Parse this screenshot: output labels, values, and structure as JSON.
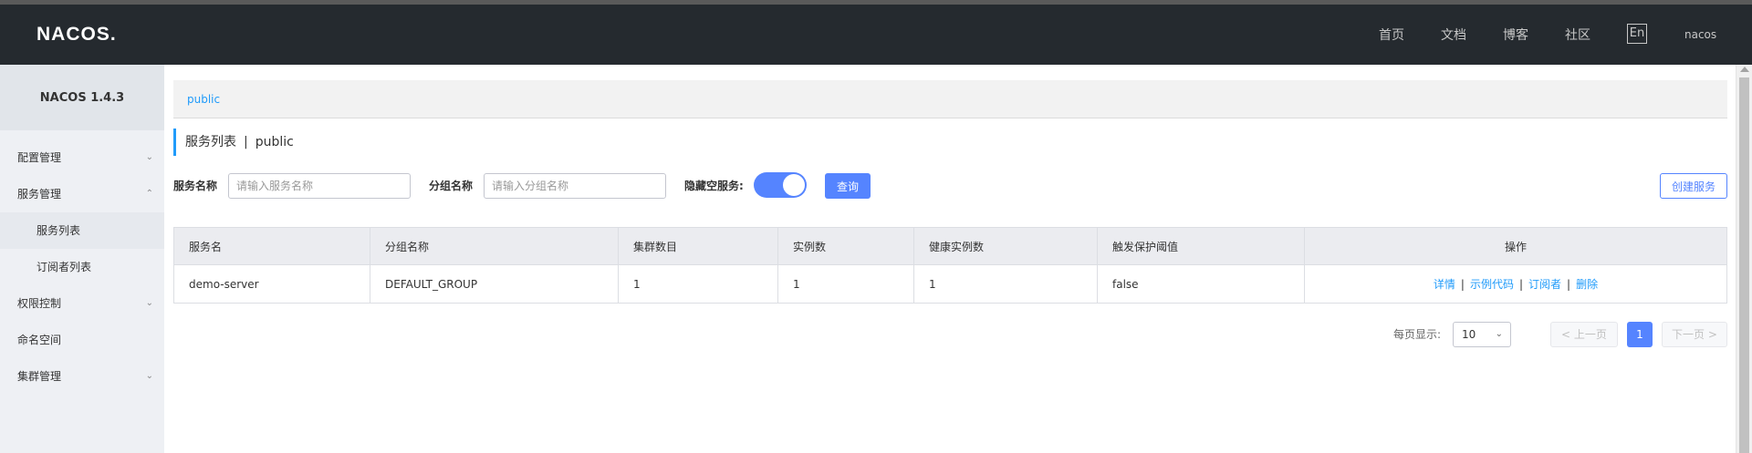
{
  "header": {
    "logo": "NACOS.",
    "nav": [
      "首页",
      "文档",
      "博客",
      "社区"
    ],
    "lang": "En",
    "user": "nacos"
  },
  "sidebar": {
    "title": "NACOS 1.4.3",
    "items": [
      {
        "label": "配置管理"
      },
      {
        "label": "服务管理"
      },
      {
        "label": "服务列表"
      },
      {
        "label": "订阅者列表"
      },
      {
        "label": "权限控制"
      },
      {
        "label": "命名空间"
      },
      {
        "label": "集群管理"
      }
    ]
  },
  "breadcrumb": "public",
  "page_title": {
    "title": "服务列表",
    "separator": "|",
    "namespace": "public"
  },
  "filters": {
    "service_name_label": "服务名称",
    "service_name_placeholder": "请输入服务名称",
    "group_name_label": "分组名称",
    "group_name_placeholder": "请输入分组名称",
    "hide_empty_label": "隐藏空服务:",
    "hide_empty_on": true,
    "query_label": "查询",
    "create_label": "创建服务"
  },
  "table": {
    "columns": [
      "服务名",
      "分组名称",
      "集群数目",
      "实例数",
      "健康实例数",
      "触发保护阈值",
      "操作"
    ],
    "rows": [
      {
        "service": "demo-server",
        "group": "DEFAULT_GROUP",
        "clusters": "1",
        "instances": "1",
        "healthy": "1",
        "threshold": "false",
        "ops": [
          "详情",
          "示例代码",
          "订阅者",
          "删除"
        ]
      }
    ]
  },
  "pagination": {
    "page_size_label": "每页显示:",
    "page_size": "10",
    "prev": "上一页",
    "current": "1",
    "next": "下一页"
  },
  "colors": {
    "header_bg": "#252a2f",
    "primary": "#5584ff",
    "link": "#209bfa"
  }
}
